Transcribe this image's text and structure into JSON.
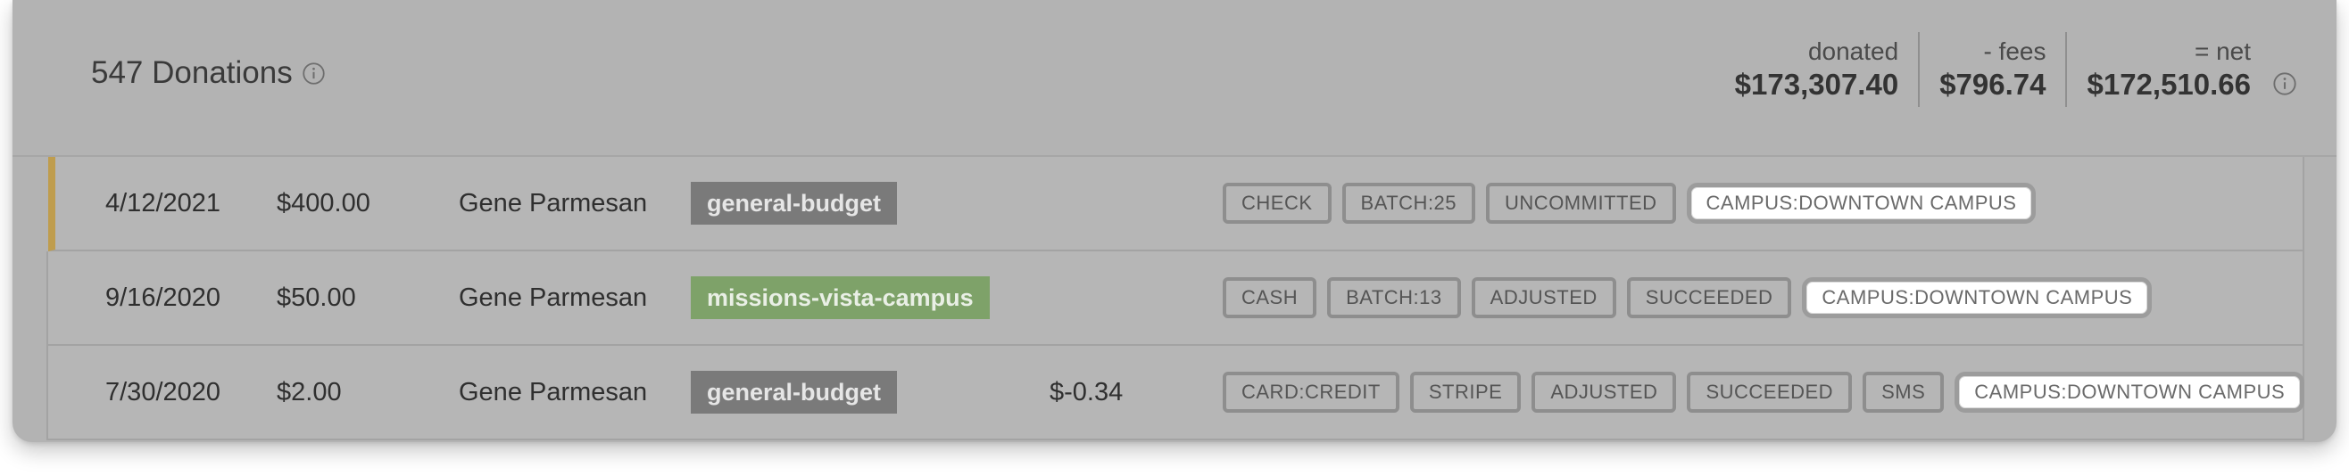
{
  "header": {
    "title": "547 Donations",
    "totals": [
      {
        "label": "donated",
        "value": "$173,307.40"
      },
      {
        "label": "- fees",
        "value": "$796.74"
      },
      {
        "label": "= net",
        "value": "$172,510.66"
      }
    ]
  },
  "donations": [
    {
      "date": "4/12/2021",
      "amount": "$400.00",
      "donor": "Gene Parmesan",
      "fund": "general-budget",
      "fee": "",
      "tags": [
        "CHECK",
        "BATCH:25",
        "UNCOMMITTED"
      ],
      "campus": "CAMPUS:DOWNTOWN CAMPUS"
    },
    {
      "date": "9/16/2020",
      "amount": "$50.00",
      "donor": "Gene Parmesan",
      "fund": "missions-vista-campus",
      "fee": "",
      "tags": [
        "CASH",
        "BATCH:13",
        "ADJUSTED",
        "SUCCEEDED"
      ],
      "campus": "CAMPUS:DOWNTOWN CAMPUS"
    },
    {
      "date": "7/30/2020",
      "amount": "$2.00",
      "donor": "Gene Parmesan",
      "fund": "general-budget",
      "fee": "$-0.34",
      "tags": [
        "CARD:CREDIT",
        "STRIPE",
        "ADJUSTED",
        "SUCCEEDED",
        "SMS"
      ],
      "campus": "CAMPUS:DOWNTOWN CAMPUS"
    }
  ],
  "colors": {
    "panel_bg": "#b3b3b3",
    "row_accent": "#bf9d4e",
    "fund_general": "#7a7a7a",
    "fund_missions": "#7ea269"
  },
  "icons": {
    "title_info": "info-circle-icon",
    "net_info": "info-circle-icon"
  }
}
